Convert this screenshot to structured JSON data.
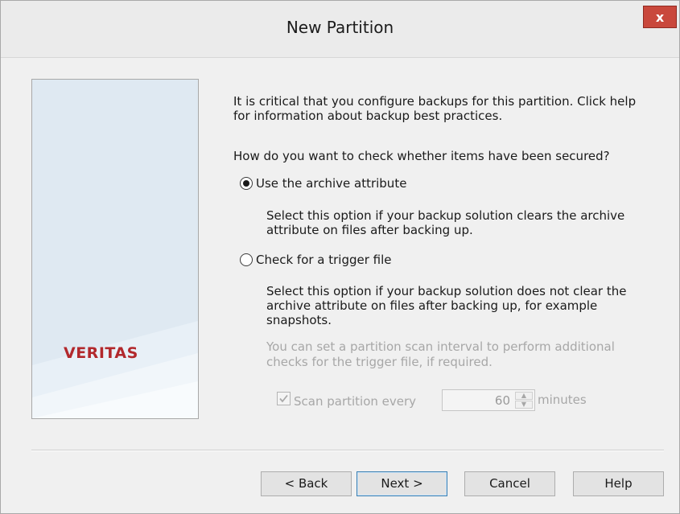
{
  "window": {
    "title": "New Partition",
    "close_label": "x"
  },
  "sidebar": {
    "logo_text": "VERITAS"
  },
  "content": {
    "intro_line1": "It is critical that you configure backups for this partition. Click help",
    "intro_line2": "for information about backup best practices.",
    "question": "How do you want to check whether items have been secured?",
    "options": [
      {
        "label": "Use the archive attribute",
        "selected": true,
        "description_lines": [
          "Select this option if your backup solution clears the archive",
          "attribute on files after backing up."
        ]
      },
      {
        "label": "Check for a trigger file",
        "selected": false,
        "description_lines": [
          "Select this option if your backup solution does not clear the",
          "archive attribute on files after backing up, for example",
          "snapshots."
        ]
      }
    ],
    "scan_note_lines": [
      "You can set a partition scan interval to perform additional",
      "checks for the trigger file, if required."
    ],
    "scan": {
      "label": "Scan partition every",
      "checked": true,
      "value": "60",
      "unit": "minutes"
    }
  },
  "buttons": {
    "back": "< Back",
    "next": "Next >",
    "cancel": "Cancel",
    "help": "Help"
  }
}
